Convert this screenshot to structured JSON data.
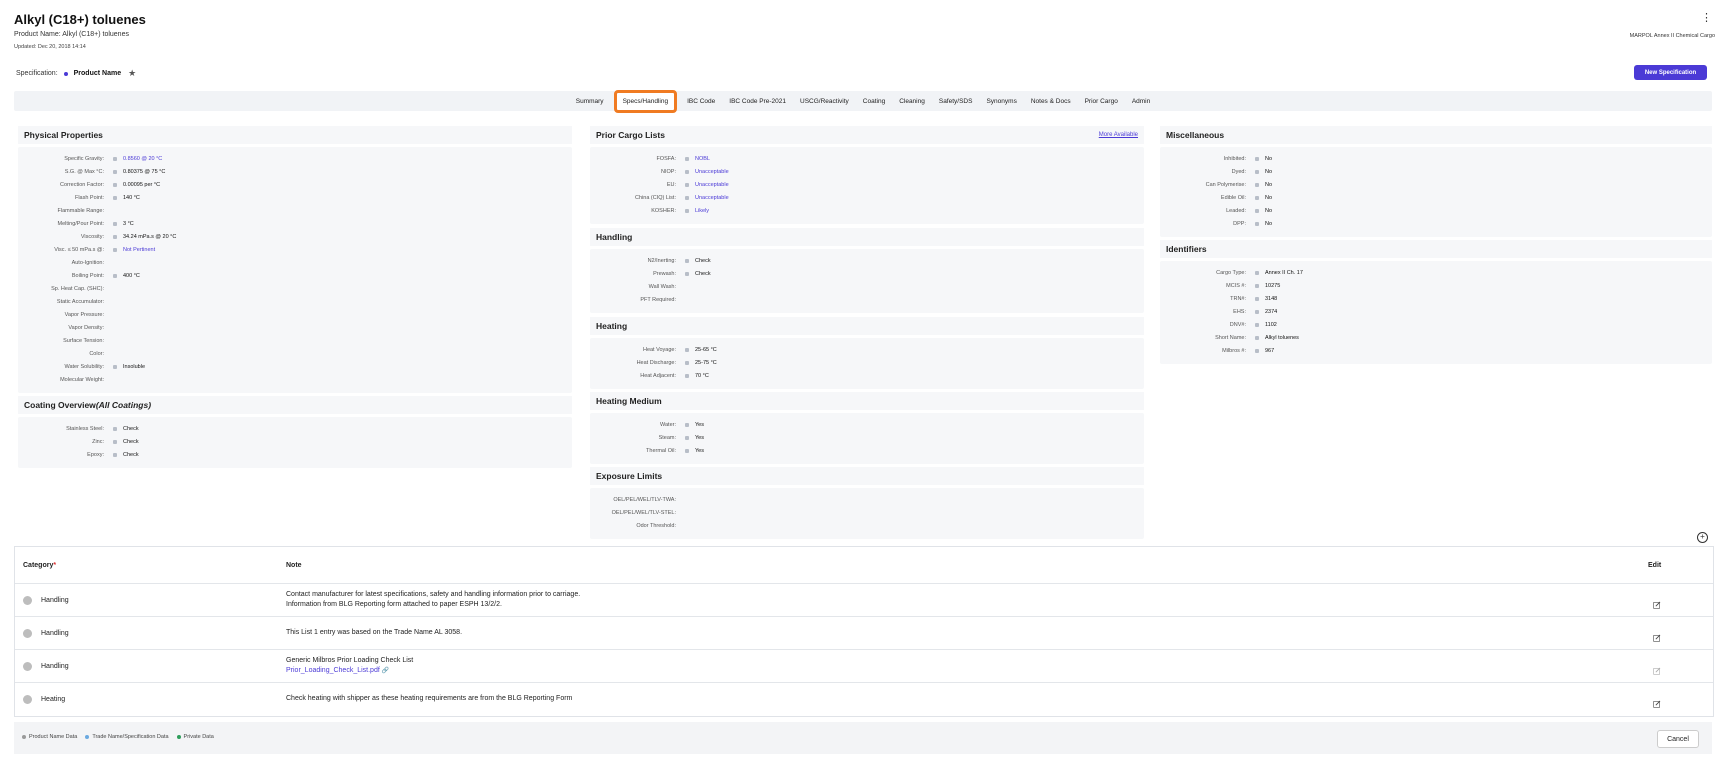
{
  "header": {
    "title": "Alkyl (C18+) toluenes",
    "product_name": "Product Name: Alkyl (C18+) toluenes",
    "updated": "Updated: Dec 20, 2018 14:14",
    "doc_type": "MARPOL Annex II Chemical Cargo"
  },
  "specification": {
    "label": "Specification:",
    "name": "Product Name",
    "new_button": "New Specification"
  },
  "tabs": [
    "Summary",
    "Specs/Handling",
    "IBC Code",
    "IBC Code Pre-2021",
    "USCG/Reactivity",
    "Coating",
    "Cleaning",
    "Safety/SDS",
    "Synonyms",
    "Notes & Docs",
    "Prior Cargo",
    "Admin"
  ],
  "active_tab": "Specs/Handling",
  "physical": {
    "title": "Physical Properties",
    "rows": [
      {
        "k": "Specific Gravity:",
        "v": "0.8560 @ 20 °C",
        "link": true,
        "dot": true
      },
      {
        "k": "S.G. @ Max °C:",
        "v": "0.80375 @ 75 °C",
        "link": false,
        "dot": true
      },
      {
        "k": "Correction Factor:",
        "v": "0.00095 per °C",
        "link": false,
        "dot": true
      },
      {
        "k": "Flash Point:",
        "v": "140 °C",
        "link": false,
        "dot": true
      },
      {
        "k": "Flammable Range:",
        "v": "",
        "link": false,
        "dot": false
      },
      {
        "k": "Melting/Pour Point:",
        "v": "3 °C",
        "link": false,
        "dot": true
      },
      {
        "k": "Viscosity:",
        "v": "34.24 mPa.s @ 20 °C",
        "link": false,
        "dot": true
      },
      {
        "k": "Visc. ≤ 50 mPa.s @:",
        "v": "Not Pertinent",
        "link": true,
        "dot": true
      },
      {
        "k": "Auto-Ignition:",
        "v": "",
        "link": false,
        "dot": false
      },
      {
        "k": "Boiling Point:",
        "v": "400 °C",
        "link": false,
        "dot": true
      },
      {
        "k": "Sp. Heat Cap. (SHC):",
        "v": "",
        "link": false,
        "dot": false
      },
      {
        "k": "Static Accumulator:",
        "v": "",
        "link": false,
        "dot": false
      },
      {
        "k": "Vapor Pressure:",
        "v": "",
        "link": false,
        "dot": false
      },
      {
        "k": "Vapor Density:",
        "v": "",
        "link": false,
        "dot": false
      },
      {
        "k": "Surface Tension:",
        "v": "",
        "link": false,
        "dot": false
      },
      {
        "k": "Color:",
        "v": "",
        "link": false,
        "dot": false
      },
      {
        "k": "Water Solubility:",
        "v": "Insoluble",
        "link": false,
        "dot": true
      },
      {
        "k": "Molecular Weight:",
        "v": "",
        "link": false,
        "dot": false
      }
    ]
  },
  "coating": {
    "title": "Coating Overview",
    "title_suffix": "(All Coatings)",
    "rows": [
      {
        "k": "Stainless Steel:",
        "v": "Check",
        "link": false,
        "dot": true
      },
      {
        "k": "Zinc:",
        "v": "Check",
        "link": false,
        "dot": true
      },
      {
        "k": "Epoxy:",
        "v": "Check",
        "link": false,
        "dot": true
      }
    ]
  },
  "prior_cargo": {
    "title": "Prior Cargo Lists",
    "more": "More Available",
    "rows": [
      {
        "k": "FOSFA:",
        "v": "NOBL",
        "link": true,
        "dot": true
      },
      {
        "k": "NIOP:",
        "v": "Unacceptable",
        "link": true,
        "dot": true
      },
      {
        "k": "EU:",
        "v": "Unacceptable",
        "link": true,
        "dot": true
      },
      {
        "k": "China (CIQ) List:",
        "v": "Unacceptable",
        "link": true,
        "dot": true
      },
      {
        "k": "KOSHER:",
        "v": "Likely",
        "link": true,
        "dot": true
      }
    ]
  },
  "handling": {
    "title": "Handling",
    "rows": [
      {
        "k": "N2/Inerting:",
        "v": "Check",
        "link": false,
        "dot": true
      },
      {
        "k": "Prewash:",
        "v": "Check",
        "link": false,
        "dot": true
      },
      {
        "k": "Wall Wash:",
        "v": "",
        "link": false,
        "dot": false
      },
      {
        "k": "PFT Required:",
        "v": "",
        "link": false,
        "dot": false
      }
    ]
  },
  "heating": {
    "title": "Heating",
    "rows": [
      {
        "k": "Heat Voyage:",
        "v": "25-65 °C",
        "link": false,
        "dot": true
      },
      {
        "k": "Heat Discharge:",
        "v": "25-75 °C",
        "link": false,
        "dot": true
      },
      {
        "k": "Heat Adjacent:",
        "v": "70 °C",
        "link": false,
        "dot": true
      }
    ]
  },
  "heating_medium": {
    "title": "Heating Medium",
    "rows": [
      {
        "k": "Water:",
        "v": "Yes",
        "link": false,
        "dot": true
      },
      {
        "k": "Steam:",
        "v": "Yes",
        "link": false,
        "dot": true
      },
      {
        "k": "Thermal Oil:",
        "v": "Yes",
        "link": false,
        "dot": true
      }
    ]
  },
  "exposure": {
    "title": "Exposure Limits",
    "rows": [
      {
        "k": "OEL/PEL/WEL/TLV-TWA:",
        "v": "",
        "link": false,
        "dot": false
      },
      {
        "k": "OEL/PEL/WEL/TLV-STEL:",
        "v": "",
        "link": false,
        "dot": false
      },
      {
        "k": "Odor Threshold:",
        "v": "",
        "link": false,
        "dot": false
      }
    ]
  },
  "misc": {
    "title": "Miscellaneous",
    "rows": [
      {
        "k": "Inhibited:",
        "v": "No",
        "link": false,
        "dot": true
      },
      {
        "k": "Dyed:",
        "v": "No",
        "link": false,
        "dot": true
      },
      {
        "k": "Can Polymerise:",
        "v": "No",
        "link": false,
        "dot": true
      },
      {
        "k": "Edible Oil:",
        "v": "No",
        "link": false,
        "dot": true
      },
      {
        "k": "Leaded:",
        "v": "No",
        "link": false,
        "dot": true
      },
      {
        "k": "DPP:",
        "v": "No",
        "link": false,
        "dot": true
      }
    ]
  },
  "identifiers": {
    "title": "Identifiers",
    "rows": [
      {
        "k": "Cargo Type:",
        "v": "Annex II Ch. 17",
        "link": false,
        "dot": true
      },
      {
        "k": "MCIS #:",
        "v": "10275",
        "link": false,
        "dot": true
      },
      {
        "k": "TRN#:",
        "v": "3148",
        "link": false,
        "dot": true
      },
      {
        "k": "EHS:",
        "v": "2374",
        "link": false,
        "dot": true
      },
      {
        "k": "DNV#:",
        "v": "1102",
        "link": false,
        "dot": true
      },
      {
        "k": "Short Name:",
        "v": "Alkyl toluenes",
        "link": false,
        "dot": true
      },
      {
        "k": "Milbros #:",
        "v": "967",
        "link": false,
        "dot": true
      }
    ]
  },
  "notes": {
    "headers": {
      "category": "Category",
      "required_mark": "*",
      "note": "Note",
      "edit": "Edit"
    },
    "rows": [
      {
        "category": "Handling",
        "lines": [
          "Contact manufacturer for latest specifications, safety and handling information prior to carriage.",
          "Information from BLG Reporting form attached to paper ESPH 13/2/2."
        ],
        "link": ""
      },
      {
        "category": "Handling",
        "lines": [
          "This List 1 entry was based on the Trade Name AL 3058."
        ],
        "link": ""
      },
      {
        "category": "Handling",
        "lines": [
          "Generic Milbros Prior Loading Check List"
        ],
        "link": "Prior_Loading_Check_List.pdf"
      },
      {
        "category": "Heating",
        "lines": [
          "Check heating with shipper as these heating requirements are from the BLG Reporting Form"
        ],
        "link": ""
      }
    ]
  },
  "footer": {
    "legend": [
      {
        "label": "Product Name Data",
        "color": "#9a9a9a"
      },
      {
        "label": "Trade Name/Specification Data",
        "color": "#6aa9e0"
      },
      {
        "label": "Private Data",
        "color": "#2e9d5b"
      }
    ],
    "cancel": "Cancel"
  }
}
